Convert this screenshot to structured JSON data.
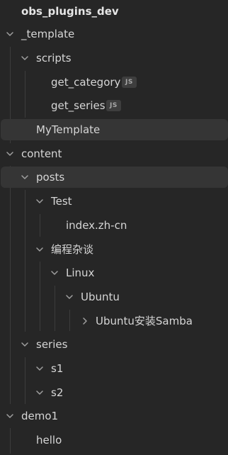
{
  "vault": {
    "name": "obs_plugins_dev"
  },
  "tree": {
    "template_folder": "_template",
    "scripts_folder": "scripts",
    "get_category": "get_category",
    "get_category_badge": "JS",
    "get_series": "get_series",
    "get_series_badge": "JS",
    "mytemplate": "MyTemplate",
    "content_folder": "content",
    "posts_folder": "posts",
    "test_folder": "Test",
    "index_file": "index.zh-cn",
    "biancheng_folder": "编程杂谈",
    "linux_folder": "Linux",
    "ubuntu_folder": "Ubuntu",
    "ubuntu_samba_folder": "Ubuntu安装Samba",
    "series_folder": "series",
    "s1_folder": "s1",
    "s2_folder": "s2",
    "demo1_folder": "demo1",
    "hello_file": "hello"
  },
  "icons": {
    "expanded": "chevron-down-icon",
    "collapsed": "chevron-right-icon"
  },
  "colors": {
    "background": "#262626",
    "text": "#d6d6d6",
    "selected_row": "#353535",
    "badge_bg": "#3e3e3e"
  }
}
